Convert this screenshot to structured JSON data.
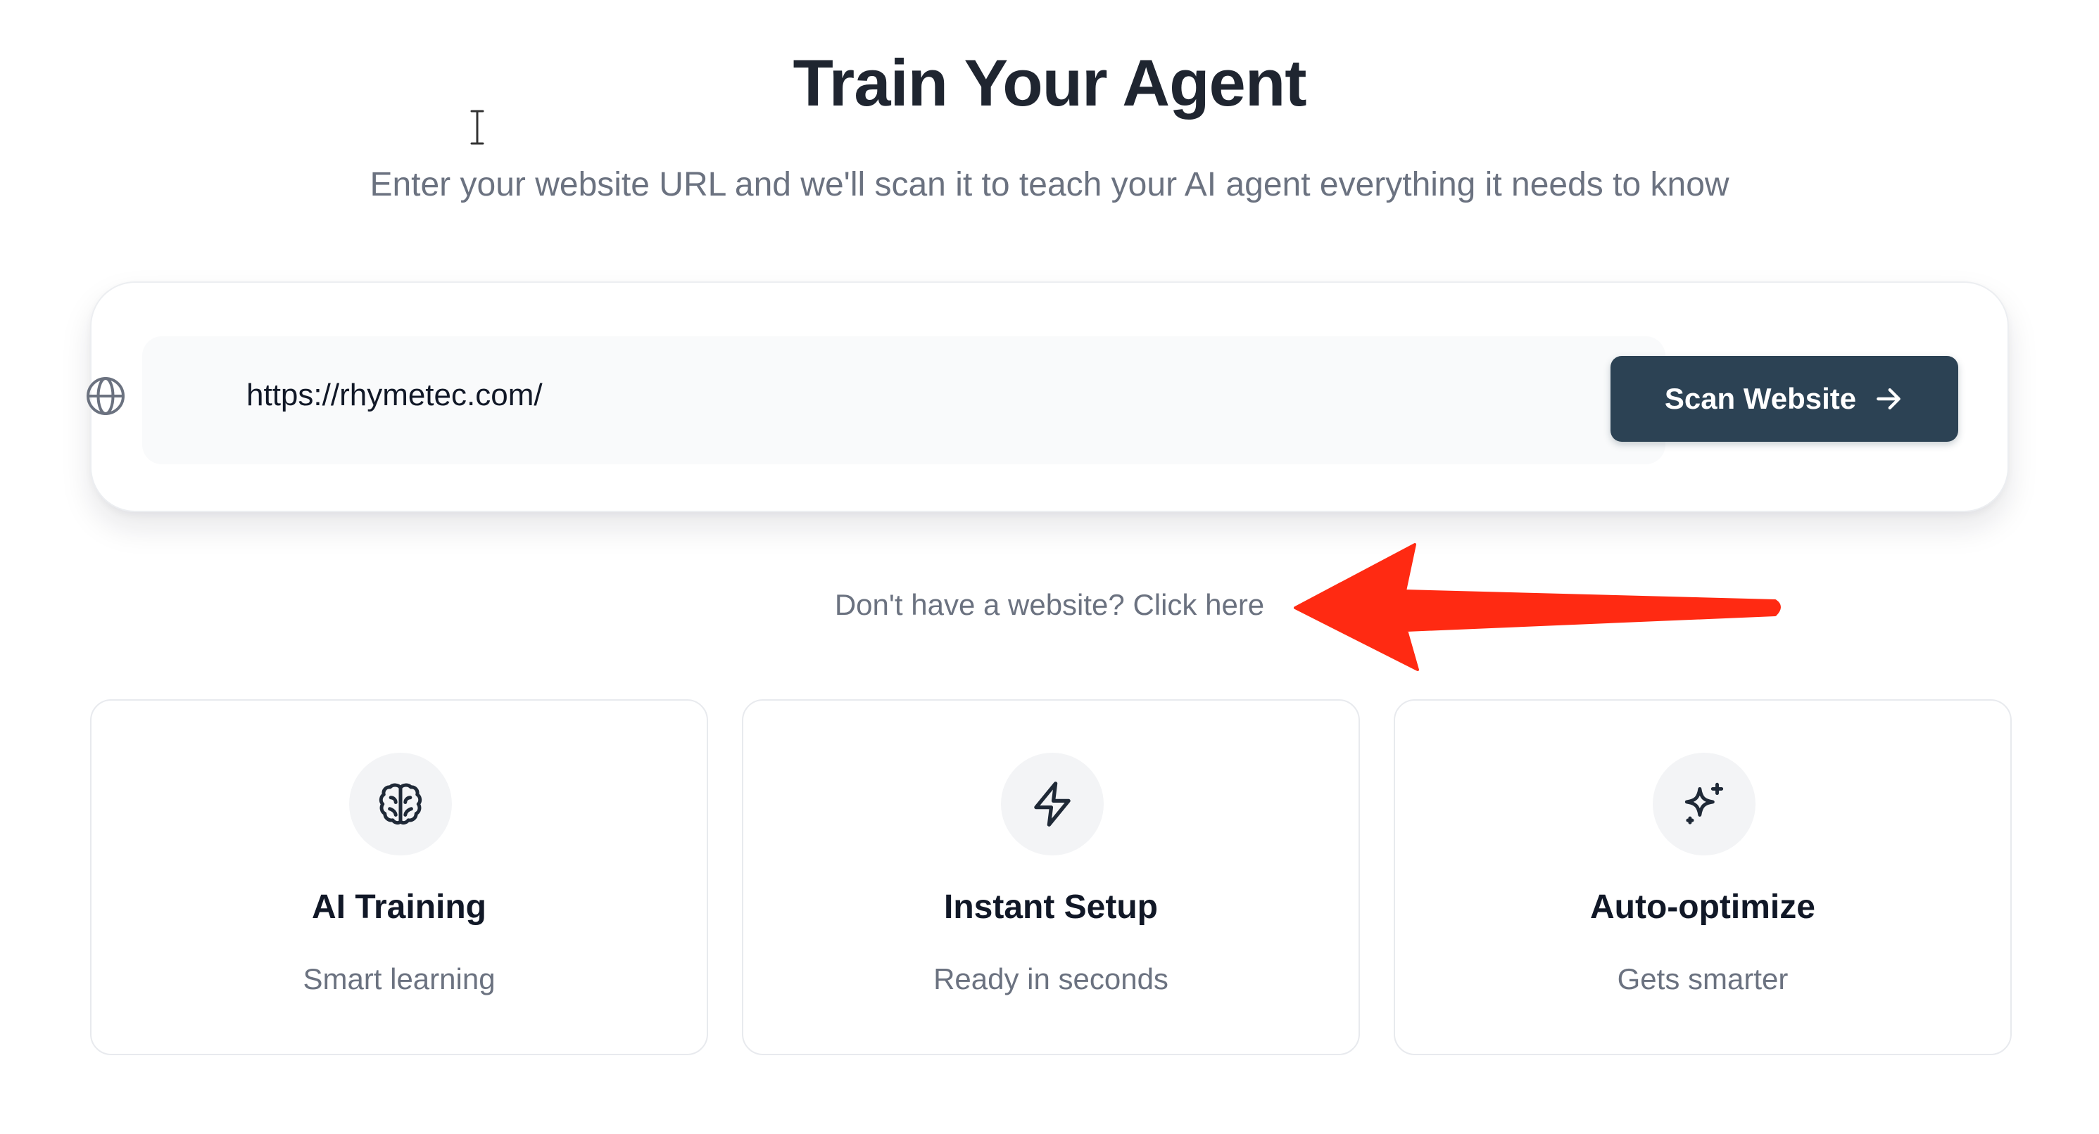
{
  "header": {
    "title": "Train Your Agent",
    "subtitle": "Enter your website URL and we'll scan it to teach your AI agent everything it needs to know"
  },
  "scan": {
    "url_value": "https://rhymetec.com/",
    "globe_icon": "globe-icon",
    "button_label": "Scan Website",
    "button_icon": "arrow-right-icon",
    "button_color": "#2c4254"
  },
  "no_website": {
    "link_text": "Don't have a website? Click here"
  },
  "annotation": {
    "arrow_color": "#ff2a12"
  },
  "features": [
    {
      "icon": "brain-icon",
      "title": "AI Training",
      "subtitle": "Smart learning"
    },
    {
      "icon": "lightning-icon",
      "title": "Instant Setup",
      "subtitle": "Ready in seconds"
    },
    {
      "icon": "sparkles-icon",
      "title": "Auto-optimize",
      "subtitle": "Gets smarter"
    }
  ]
}
